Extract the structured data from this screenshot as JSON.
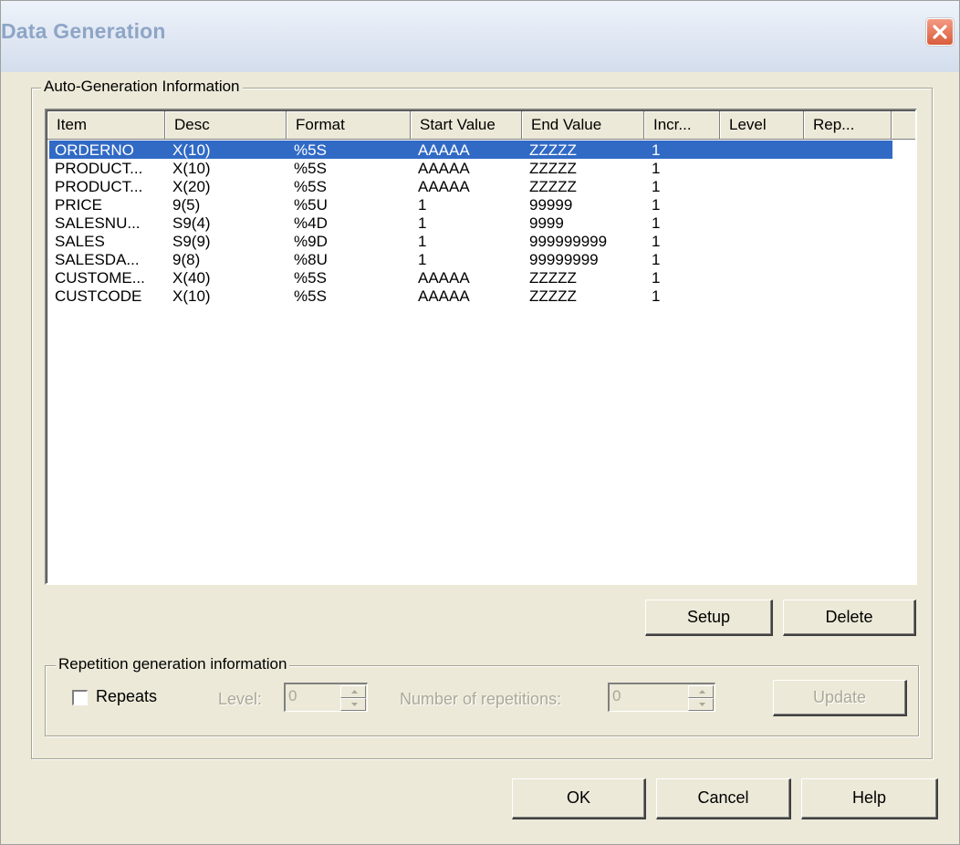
{
  "window": {
    "title": "Data Generation"
  },
  "auto_group": {
    "label": "Auto-Generation Information",
    "columns": [
      "Item",
      "Desc",
      "Format",
      "Start Value",
      "End Value",
      "Incr...",
      "Level",
      "Rep..."
    ],
    "rows": [
      [
        "ORDERNO",
        "X(10)",
        "%5S",
        "AAAAA",
        "ZZZZZ",
        "1",
        "",
        ""
      ],
      [
        "PRODUCT...",
        "X(10)",
        "%5S",
        "AAAAA",
        "ZZZZZ",
        "1",
        "",
        ""
      ],
      [
        "PRODUCT...",
        "X(20)",
        "%5S",
        "AAAAA",
        "ZZZZZ",
        "1",
        "",
        ""
      ],
      [
        "PRICE",
        "9(5)",
        "%5U",
        "1",
        "99999",
        "1",
        "",
        ""
      ],
      [
        "SALESNU...",
        "S9(4)",
        "%4D",
        "1",
        "9999",
        "1",
        "",
        ""
      ],
      [
        "SALES",
        "S9(9)",
        "%9D",
        "1",
        "999999999",
        "1",
        "",
        ""
      ],
      [
        "SALESDA...",
        "9(8)",
        "%8U",
        "1",
        "99999999",
        "1",
        "",
        ""
      ],
      [
        "CUSTOME...",
        "X(40)",
        "%5S",
        "AAAAA",
        "ZZZZZ",
        "1",
        "",
        ""
      ],
      [
        "CUSTCODE",
        "X(10)",
        "%5S",
        "AAAAA",
        "ZZZZZ",
        "1",
        "",
        ""
      ]
    ],
    "selected_row": 0,
    "setup_label": "Setup",
    "delete_label": "Delete"
  },
  "repetition_group": {
    "label": "Repetition generation information",
    "repeats_label": "Repeats",
    "repeats_checked": false,
    "level_label": "Level:",
    "level_value": "0",
    "reps_label": "Number of repetitions:",
    "reps_value": "0",
    "update_label": "Update"
  },
  "footer": {
    "ok_label": "OK",
    "cancel_label": "Cancel",
    "help_label": "Help"
  }
}
